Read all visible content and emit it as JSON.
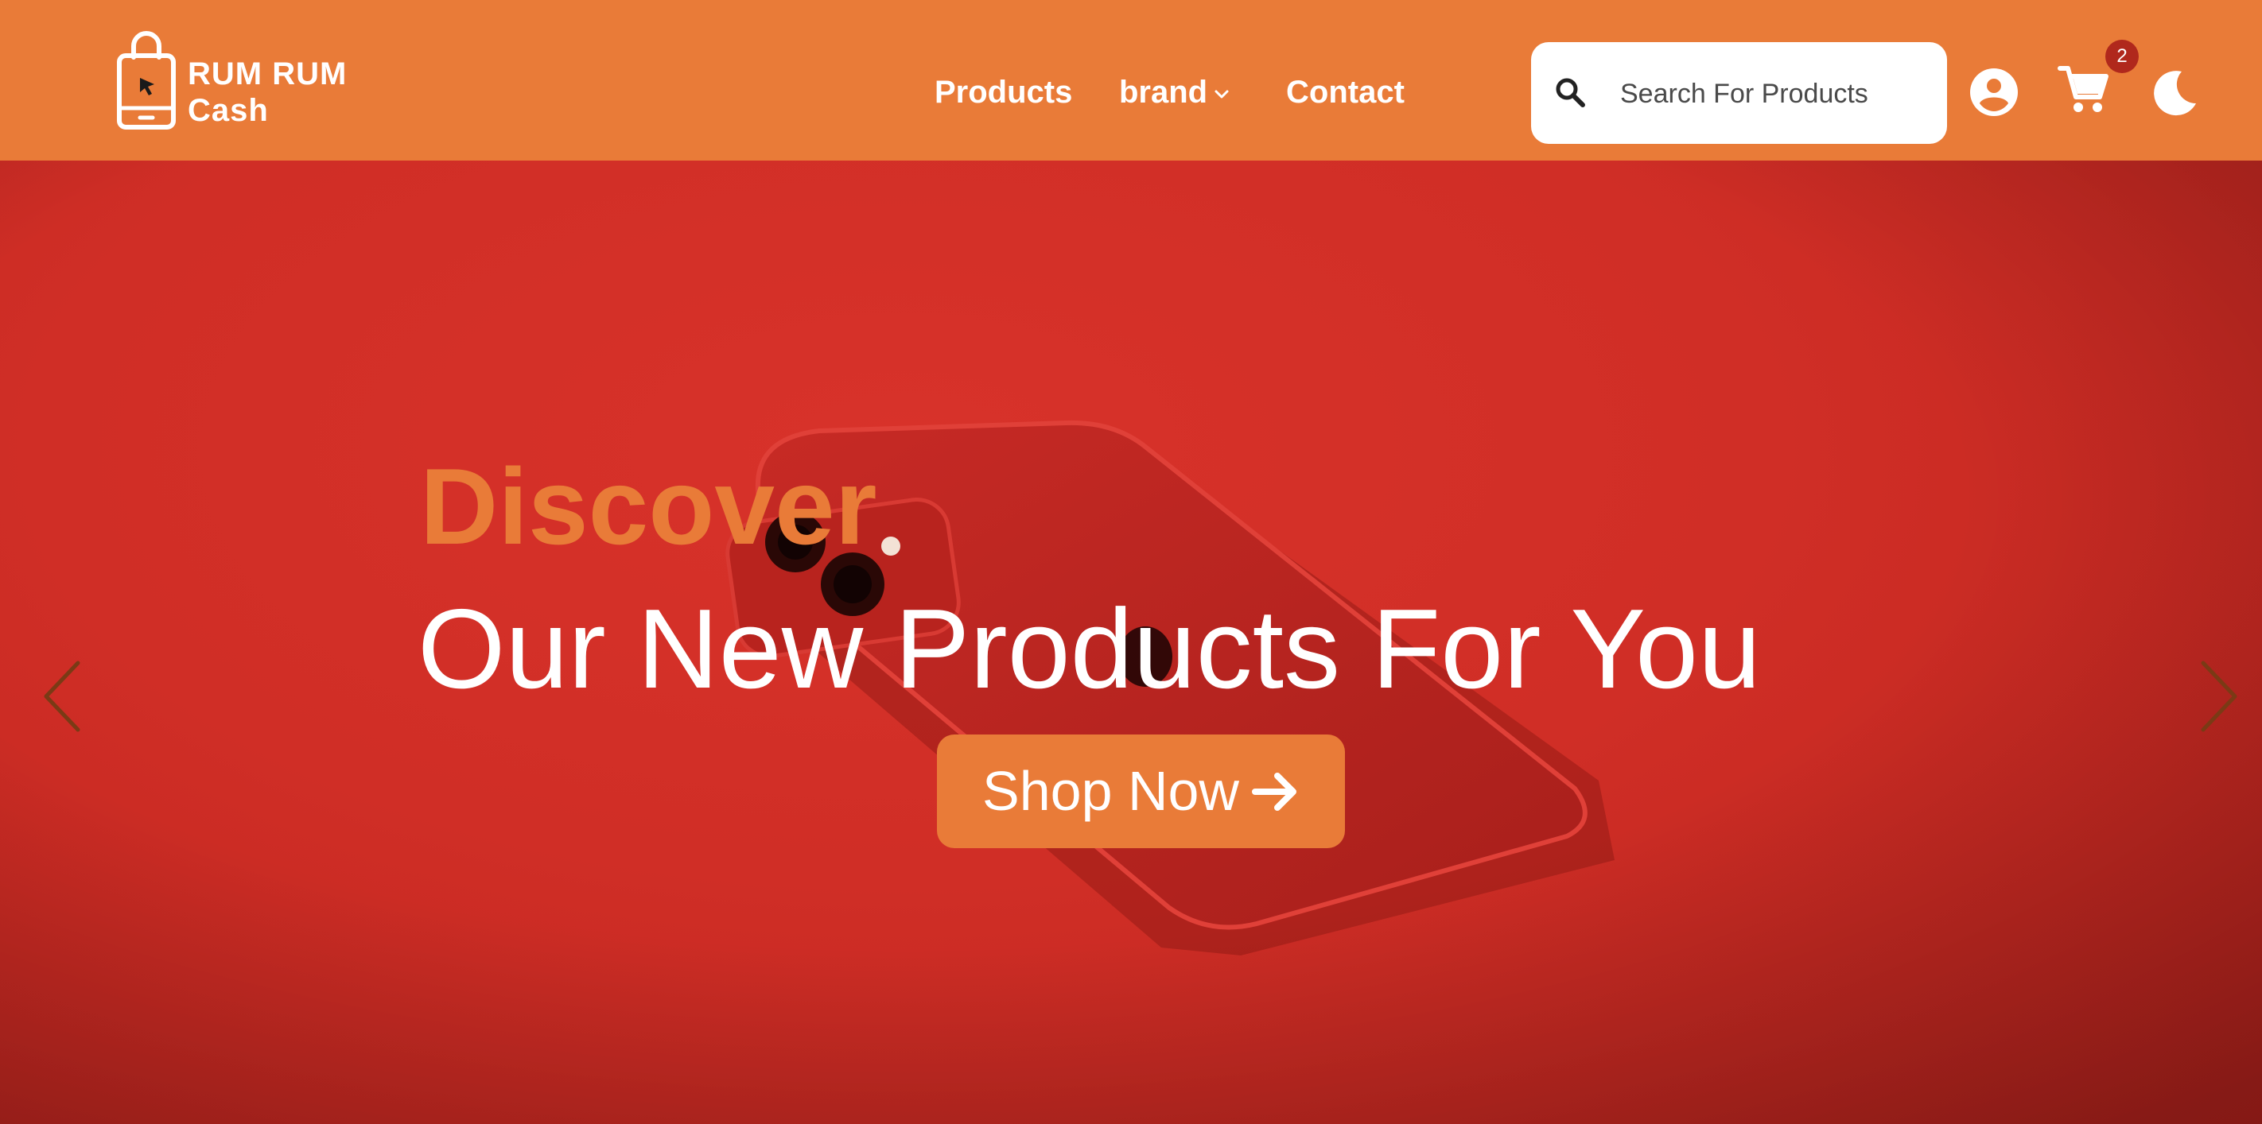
{
  "brand": {
    "name_line1": "RUM RUM",
    "name_line2": "Cash",
    "logo_icon": "shopping-bag-cursor-icon"
  },
  "nav": {
    "products": "Products",
    "brand": "brand",
    "contact": "Contact"
  },
  "search": {
    "placeholder": "Search For Products",
    "value": "",
    "icon": "search-icon"
  },
  "header_icons": {
    "account": "account-circle-icon",
    "cart": "shopping-cart-icon",
    "cart_count": "2",
    "theme": "moon-icon"
  },
  "hero": {
    "eyebrow": "Discover",
    "title": "Our New Products For You",
    "cta_label": "Shop Now",
    "cta_icon": "arrow-right-icon",
    "prev_icon": "chevron-left-icon",
    "next_icon": "chevron-right-icon"
  },
  "colors": {
    "accent": "#e97b38",
    "hero_background": "#d02e26",
    "badge": "#b0281c",
    "text_light": "#ffffff"
  }
}
